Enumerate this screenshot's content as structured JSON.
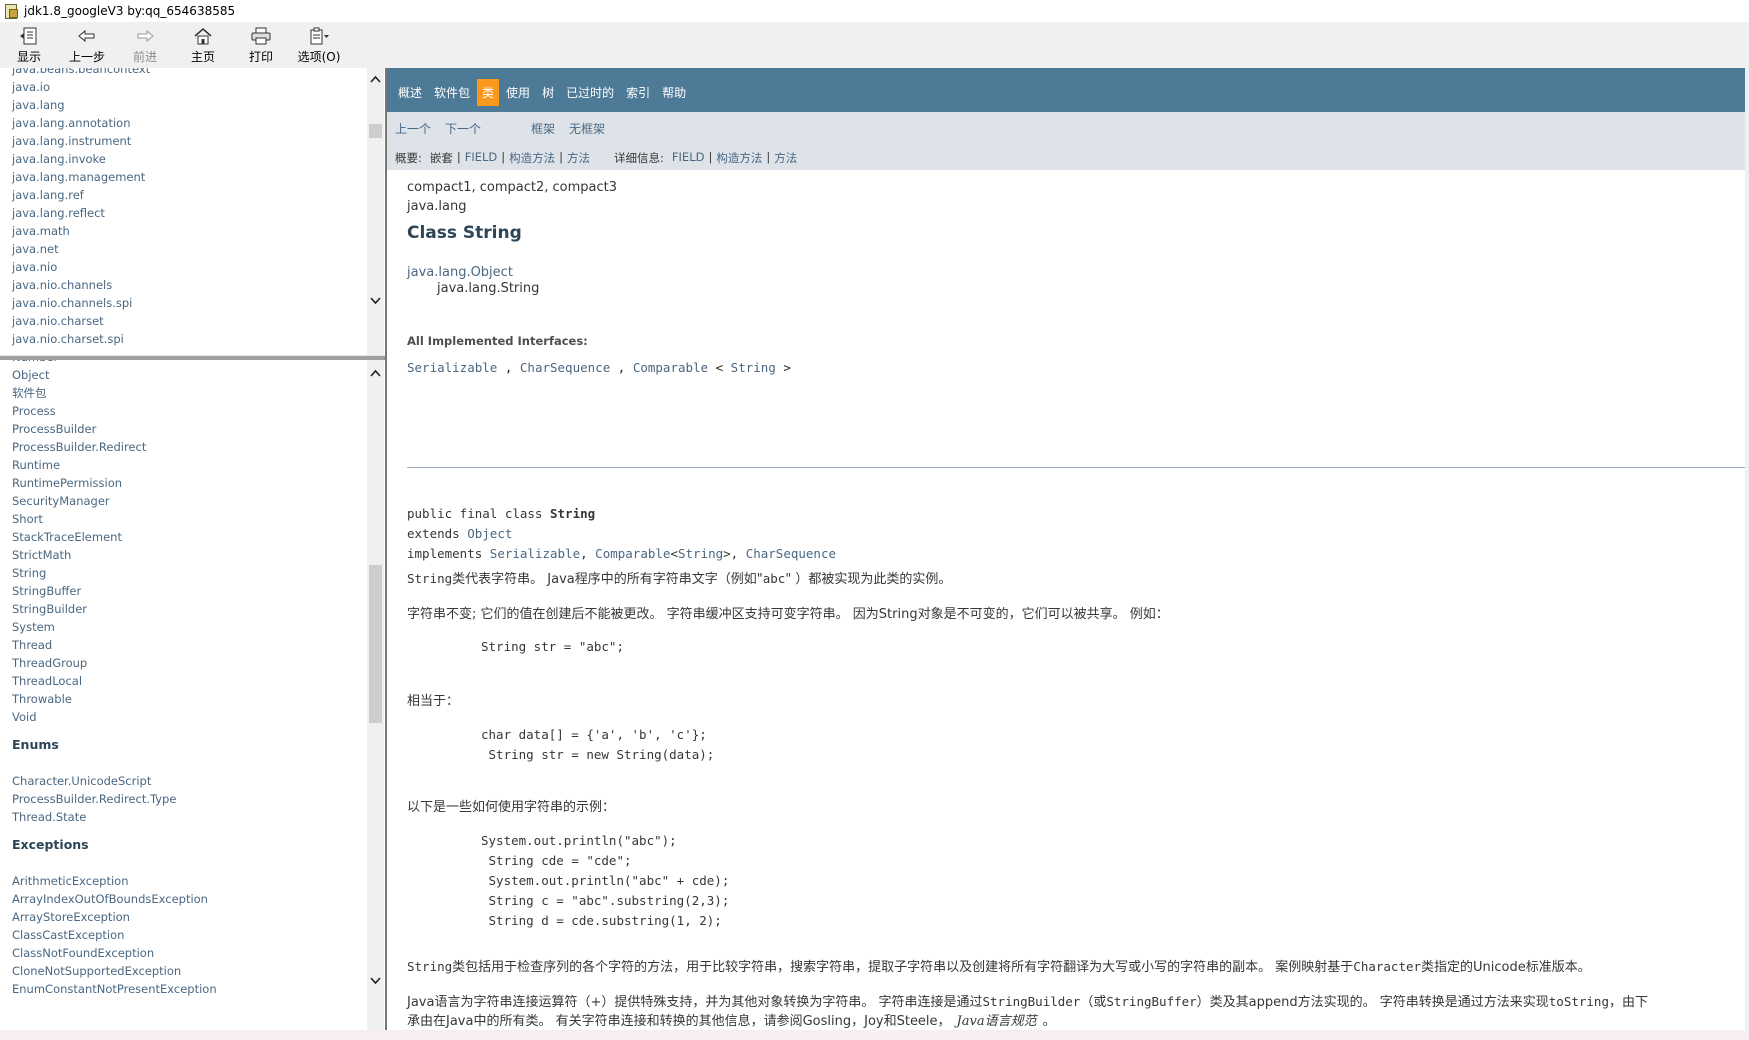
{
  "window": {
    "title": "jdk1.8_googleV3 by:qq_654638585"
  },
  "toolbar": [
    {
      "label": "显示",
      "icon": "show-pane-icon",
      "enabled": true
    },
    {
      "label": "上一步",
      "icon": "back-arrow-icon",
      "enabled": true
    },
    {
      "label": "前进",
      "icon": "forward-arrow-icon",
      "enabled": false
    },
    {
      "label": "主页",
      "icon": "home-icon",
      "enabled": true
    },
    {
      "label": "打印",
      "icon": "print-icon",
      "enabled": true
    },
    {
      "label": "选项(O)",
      "icon": "options-icon",
      "enabled": true
    }
  ],
  "packages": [
    "java.beans.beancontext",
    "java.io",
    "java.lang",
    "java.lang.annotation",
    "java.lang.instrument",
    "java.lang.invoke",
    "java.lang.management",
    "java.lang.ref",
    "java.lang.reflect",
    "java.math",
    "java.net",
    "java.nio",
    "java.nio.channels",
    "java.nio.channels.spi",
    "java.nio.charset",
    "java.nio.charset.spi"
  ],
  "classes_top": [
    "Number",
    "Object",
    "软件包",
    "Process",
    "ProcessBuilder",
    "ProcessBuilder.Redirect",
    "Runtime",
    "RuntimePermission",
    "SecurityManager",
    "Short",
    "StackTraceElement",
    "StrictMath",
    "String",
    "StringBuffer",
    "StringBuilder",
    "System",
    "Thread",
    "ThreadGroup",
    "ThreadLocal",
    "Throwable",
    "Void"
  ],
  "enums_heading": "Enums",
  "enums": [
    "Character.UnicodeScript",
    "ProcessBuilder.Redirect.Type",
    "Thread.State"
  ],
  "exceptions_heading": "Exceptions",
  "exceptions": [
    "ArithmeticException",
    "ArrayIndexOutOfBoundsException",
    "ArrayStoreException",
    "ClassCastException",
    "ClassNotFoundException",
    "CloneNotSupportedException",
    "EnumConstantNotPresentException"
  ],
  "topnav": {
    "items": [
      "概述",
      "软件包",
      "类",
      "使用",
      "树",
      "已过时的",
      "索引",
      "帮助"
    ],
    "active_index": 2
  },
  "subnav": {
    "prev": "上一个",
    "next": "下一个",
    "frames": "框架",
    "noframes": "无框架",
    "summary_label": "概要:",
    "summary_nested": "嵌套",
    "summary_field": "FIELD",
    "summary_constr": "构造方法",
    "summary_method": "方法",
    "detail_label": "详细信息:",
    "detail_field": "FIELD",
    "detail_constr": "构造方法",
    "detail_method": "方法",
    "pipe": "|"
  },
  "doc": {
    "profiles": "compact1, compact2, compact3",
    "package": "java.lang",
    "title": "Class String",
    "inherit_parent": "java.lang.Object",
    "inherit_child": "java.lang.String",
    "interfaces_label": "All Implemented Interfaces:",
    "iface1": "Serializable",
    "iface2": "CharSequence",
    "iface3": "Comparable",
    "iface3_arg": "String",
    "sig_public": "public final class ",
    "sig_name": "String",
    "sig_extends": "extends ",
    "sig_super": "Object",
    "sig_implements": "implements ",
    "sig_i1": "Serializable",
    "sig_i2": "Comparable",
    "sig_i2_arg": "String",
    "sig_i3": "CharSequence",
    "p1_code": "String",
    "p1_text": "类代表字符串。 Java程序中的所有字符串文字（例如\"",
    "p1_code2": "abc",
    "p1_tail": "\" ）都被实现为此类的实例。",
    "p2": "字符串不变; 它们的值在创建后不能被更改。 字符串缓冲区支持可变字符串。 因为String对象是不可变的，它们可以被共享。 例如：",
    "code1": "String str = \"abc\";",
    "p3": "相当于：",
    "code2_l1": "char data[] = {'a', 'b', 'c'};",
    "code2_l2": " String str = new String(data);",
    "p4": "以下是一些如何使用字符串的示例：",
    "code3_l1": "System.out.println(\"abc\");",
    "code3_l2": " String cde = \"cde\";",
    "code3_l3": " System.out.println(\"abc\" + cde);",
    "code3_l4": " String c = \"abc\".substring(2,3);",
    "code3_l5": " String d = cde.substring(1, 2);",
    "p5_code": "String",
    "p5_text": "类包括用于检查序列的各个字符的方法，用于比较字符串，搜索字符串，提取子字符串以及创建将所有字符翻译为大写或小写的字符串的副本。 案例映射基于",
    "p5_link": "Character",
    "p5_tail": "类指定的Unicode标准版本。",
    "p6_a": "Java语言为字符串连接运算符（+）提供特殊支持，并为其他对象转换为字符串。 字符串连接是通过",
    "p6_code1": "StringBuilder",
    "p6_b": "（或",
    "p6_code2": "StringBuffer",
    "p6_c": "）类及其append方法实现的。 字符串转换是通过方法来实现",
    "p6_code3": "toString",
    "p6_d": "，由下",
    "p7_a": "承由在Java中的所有类。 有关字符串连接和转换的其他信息，请参阅Gosling，Joy和Steele，",
    "p7_ital": "Java语言规范",
    "p7_b": "。"
  }
}
